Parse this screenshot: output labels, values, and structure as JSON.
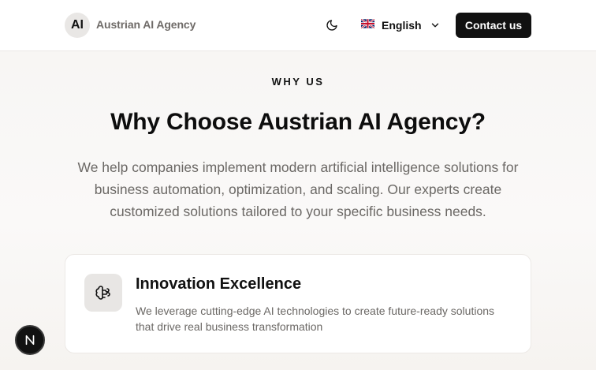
{
  "header": {
    "logo_text": "AI",
    "brand_name": "Austrian AI Agency",
    "theme_icon": "moon-icon",
    "language": {
      "label": "English",
      "flag_icon": "uk-flag-icon"
    },
    "contact_label": "Contact us"
  },
  "section": {
    "eyebrow": "WHY US",
    "title": "Why Choose Austrian AI Agency?",
    "lead": "We help companies implement modern artificial intelligence solutions for business automation, optimization, and scaling. Our experts create customized solutions tailored to your specific business needs."
  },
  "cards": [
    {
      "icon": "brain-icon",
      "title": "Innovation Excellence",
      "text": "We leverage cutting-edge AI technologies to create future-ready solutions that drive real business transformation"
    }
  ],
  "floating": {
    "badge_label": "N"
  }
}
